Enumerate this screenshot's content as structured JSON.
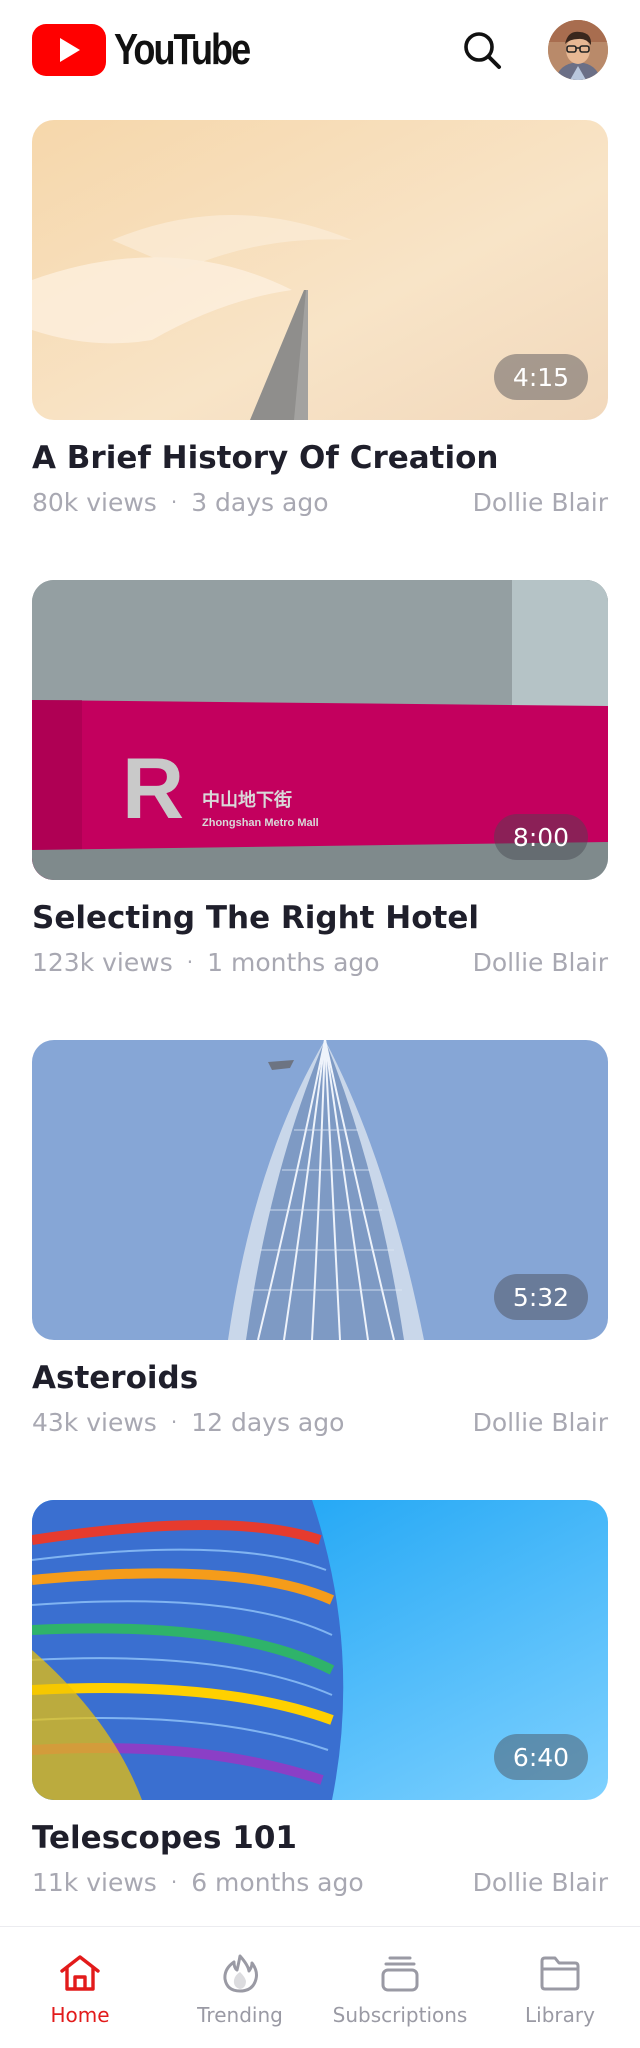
{
  "app": {
    "brand": "YouTube",
    "accent_color": "#ff0000",
    "active_color": "#e21b1b"
  },
  "header": {
    "search_icon": "search-icon",
    "avatar": "user-avatar"
  },
  "videos": [
    {
      "title": "A Brief History Of Creation",
      "views": "80k views",
      "age": "3 days ago",
      "channel": "Dollie Blair",
      "duration": "4:15"
    },
    {
      "title": "Selecting The Right Hotel",
      "views": "123k views",
      "age": "1 months ago",
      "channel": "Dollie Blair",
      "duration": "8:00"
    },
    {
      "title": "Asteroids",
      "views": "43k views",
      "age": "12 days ago",
      "channel": "Dollie Blair",
      "duration": "5:32"
    },
    {
      "title": "Telescopes 101",
      "views": "11k views",
      "age": "6 months ago",
      "channel": "Dollie Blair",
      "duration": "6:40"
    }
  ],
  "thumbnail_text": {
    "sign_letter": "R",
    "sign_chinese": "中山地下街",
    "sign_english": "Zhongshan Metro Mall"
  },
  "tabbar": {
    "items": [
      {
        "label": "Home",
        "icon": "home-icon",
        "active": true
      },
      {
        "label": "Trending",
        "icon": "flame-icon",
        "active": false
      },
      {
        "label": "Subscriptions",
        "icon": "subscriptions-icon",
        "active": false
      },
      {
        "label": "Library",
        "icon": "folder-icon",
        "active": false
      }
    ]
  }
}
